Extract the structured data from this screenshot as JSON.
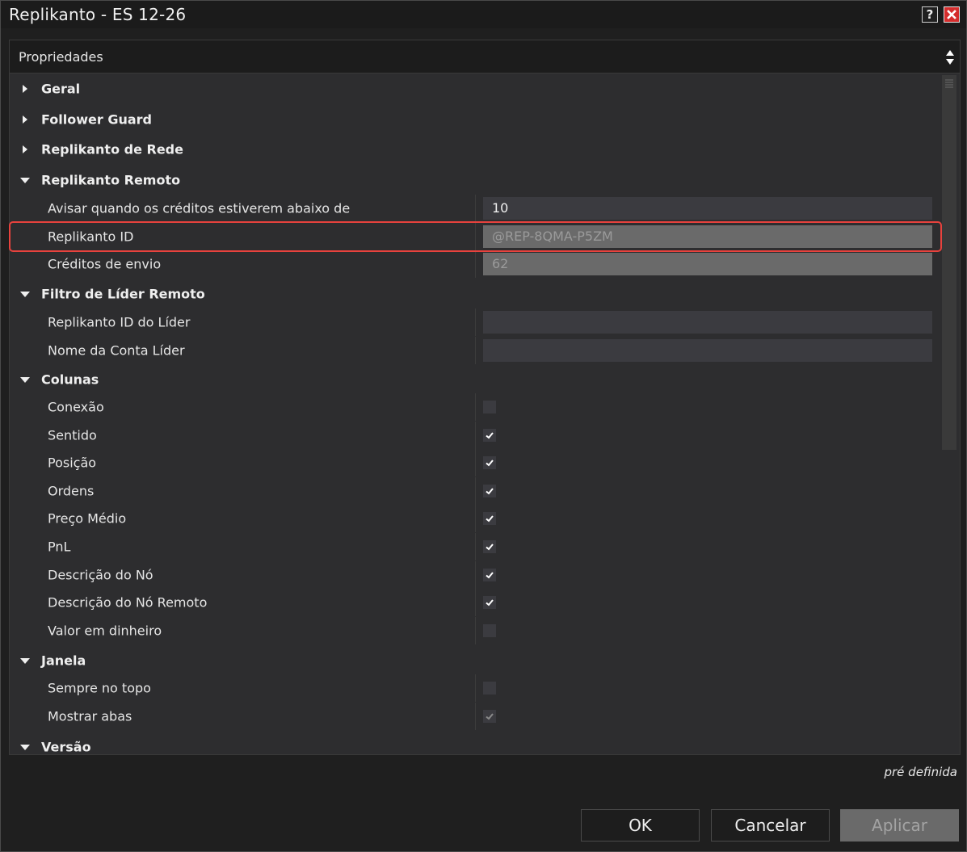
{
  "window": {
    "title": "Replikanto - ES 12-26",
    "help_label": "?",
    "close_label": "✕"
  },
  "panel": {
    "header": "Propriedades"
  },
  "categories": {
    "geral": "Geral",
    "follower_guard": "Follower Guard",
    "replikanto_rede": "Replikanto de Rede",
    "replikanto_remoto": "Replikanto Remoto",
    "filtro_lider": "Filtro de Líder Remoto",
    "colunas": "Colunas",
    "janela": "Janela",
    "versao": "Versão"
  },
  "replikanto_remoto": {
    "aviso_label": "Avisar quando os créditos estiverem abaixo de",
    "aviso_value": "10",
    "id_label": "Replikanto ID",
    "id_value": "@REP-8QMA-P5ZM",
    "creditos_label": "Créditos de envio",
    "creditos_value": "62"
  },
  "filtro_lider": {
    "id_label": "Replikanto ID do Líder",
    "id_value": "",
    "nome_label": "Nome da Conta Líder",
    "nome_value": ""
  },
  "colunas": [
    {
      "label": "Conexão",
      "checked": false
    },
    {
      "label": "Sentido",
      "checked": true
    },
    {
      "label": "Posição",
      "checked": true
    },
    {
      "label": "Ordens",
      "checked": true
    },
    {
      "label": "Preço Médio",
      "checked": true
    },
    {
      "label": "PnL",
      "checked": true
    },
    {
      "label": "Descrição do Nó",
      "checked": true
    },
    {
      "label": "Descrição do Nó Remoto",
      "checked": true
    },
    {
      "label": "Valor em dinheiro",
      "checked": false
    }
  ],
  "janela": [
    {
      "label": "Sempre no topo",
      "checked": false
    },
    {
      "label": "Mostrar abas",
      "checked": true,
      "disabled": true
    }
  ],
  "footer": {
    "default_label": "pré definida",
    "ok": "OK",
    "cancel": "Cancelar",
    "apply": "Aplicar"
  },
  "colors": {
    "highlight": "#e8423d",
    "close_button": "#d42d2d"
  }
}
